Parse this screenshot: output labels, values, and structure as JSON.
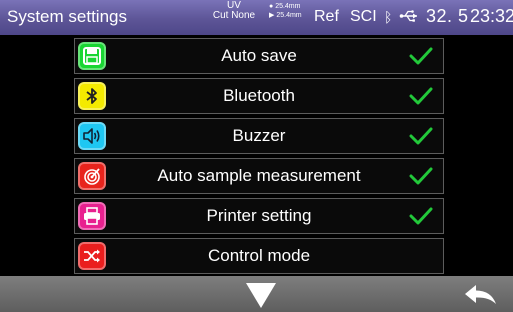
{
  "status_bar": {
    "title": "System settings",
    "uv_line1": "UV",
    "uv_line2": "Cut None",
    "dim_line1": "25.4mm",
    "dim_line2": "25.4mm",
    "ref": "Ref",
    "sci": "SCI",
    "temperature": "32. 5",
    "time": "23:32"
  },
  "settings": {
    "items": [
      {
        "label": "Auto save",
        "icon": "floppy-disk-icon",
        "icon_color": "#19d633",
        "checked": true
      },
      {
        "label": "Bluetooth",
        "icon": "bluetooth-icon",
        "icon_color": "#f4ea00",
        "checked": true
      },
      {
        "label": "Buzzer",
        "icon": "speaker-icon",
        "icon_color": "#1fc7f2",
        "checked": true
      },
      {
        "label": "Auto sample measurement",
        "icon": "target-measure-icon",
        "icon_color": "#e8231c",
        "checked": true
      },
      {
        "label": "Printer setting",
        "icon": "printer-icon",
        "icon_color": "#e8208f",
        "checked": true
      },
      {
        "label": "Control mode",
        "icon": "shuffle-icon",
        "icon_color": "#ea1e1e",
        "checked": false
      }
    ]
  },
  "colors": {
    "check": "#22c93a",
    "status_bar": "#5d5597",
    "bottom_bar": "#6e6e6e"
  },
  "bottom_bar": {
    "down_icon": "triangle-down-icon",
    "back_icon": "back-arrow-icon"
  }
}
